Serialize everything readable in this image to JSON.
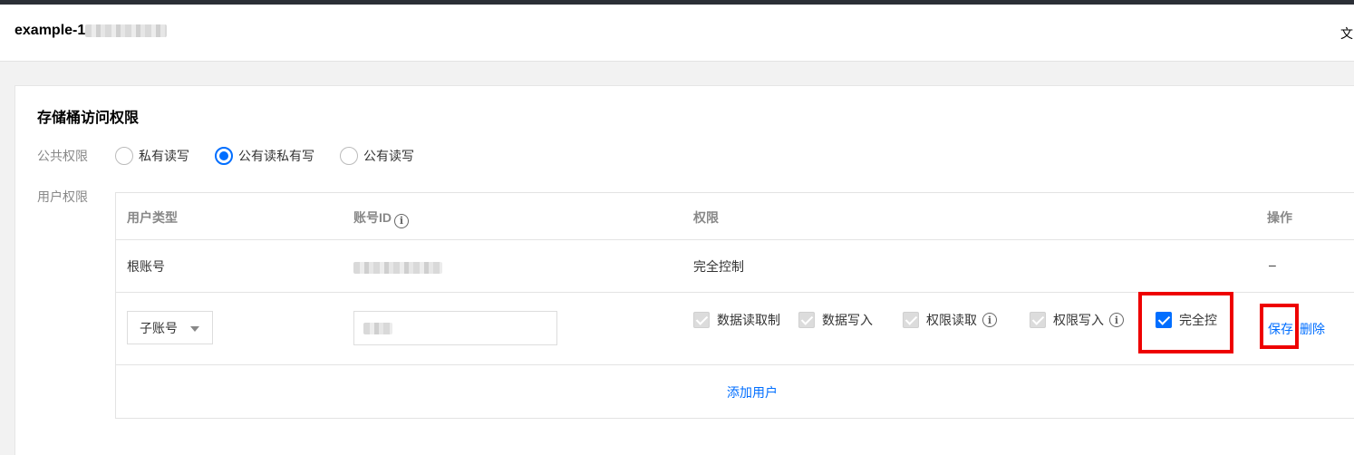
{
  "header": {
    "bucket_name": "example-1",
    "right_text": "文"
  },
  "card": {
    "title": "存储桶访问权限",
    "public_label": "公共权限",
    "user_label": "用户权限",
    "public_options": [
      {
        "label": "私有读写",
        "checked": false
      },
      {
        "label": "公有读私有写",
        "checked": true
      },
      {
        "label": "公有读写",
        "checked": false
      }
    ]
  },
  "table": {
    "columns": [
      "用户类型",
      "账号ID",
      "权限",
      "操作"
    ],
    "root_row": {
      "user_type": "根账号",
      "permission": "完全控制",
      "action": "–"
    },
    "sub_row": {
      "user_type": "子账号",
      "permissions": [
        {
          "label": "数据读取制",
          "checked": true,
          "disabled": true,
          "info": false
        },
        {
          "label": "数据写入",
          "checked": true,
          "disabled": true,
          "info": false
        },
        {
          "label": "权限读取",
          "checked": true,
          "disabled": true,
          "info": true
        },
        {
          "label": "权限写入",
          "checked": true,
          "disabled": true,
          "info": true
        },
        {
          "label": "完全控",
          "checked": true,
          "disabled": false,
          "info": false
        }
      ],
      "save": "保存",
      "delete": "删除"
    },
    "add_user": "添加用户"
  },
  "colors": {
    "accent": "#006eff",
    "highlight": "#ee0000"
  }
}
